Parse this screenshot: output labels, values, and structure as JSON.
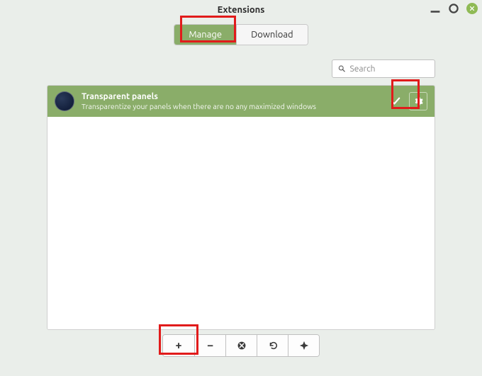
{
  "window": {
    "title": "Extensions"
  },
  "tabs": {
    "manage": "Manage",
    "download": "Download",
    "active": "manage"
  },
  "search": {
    "placeholder": "Search",
    "value": ""
  },
  "extension": {
    "title": "Transparent panels",
    "description": "Transparentize your panels when there are no any maximized windows",
    "enabled": true
  },
  "toolbar": {
    "add": "+",
    "remove": "−"
  },
  "icons": {
    "check": "check-icon",
    "gear": "gear-icon",
    "search": "search-icon",
    "close": "close-icon",
    "minimize": "minimize-icon",
    "maximize": "maximize-icon",
    "undo": "undo-icon",
    "error": "remove-circle-icon",
    "star": "action-icon"
  }
}
